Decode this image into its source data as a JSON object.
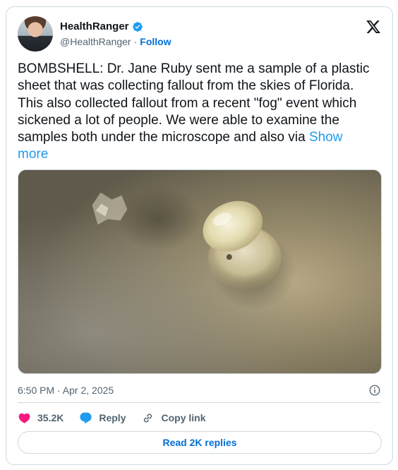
{
  "tweet": {
    "author": {
      "display_name": "HealthRanger",
      "handle": "@HealthRanger",
      "separator": "·",
      "follow_label": "Follow",
      "verified": true
    },
    "text": "BOMBSHELL: Dr. Jane Ruby sent me a sample of a plastic sheet that was collecting fallout from the skies of Florida. This also collected fallout from a recent \"fog\" event which sickened a lot of people. We were able to examine the samples both under the microscope and also via ",
    "show_more_label": "Show more",
    "timestamp": "6:50 PM · Apr 2, 2025",
    "likes": "35.2K",
    "reply_label": "Reply",
    "copy_link_label": "Copy link",
    "read_replies_label": "Read 2K replies"
  },
  "colors": {
    "link_blue": "#1d9bf0",
    "follow_blue": "#006fd6",
    "like_red": "#f91880",
    "reply_blue": "#1d9bf0",
    "secondary_text": "#536471",
    "border": "#cfd9de"
  },
  "icons": {
    "platform": "x-logo-icon",
    "verified": "verified-badge-icon",
    "info": "info-icon",
    "like": "heart-icon",
    "reply": "speech-bubble-icon",
    "copy_link": "link-icon"
  }
}
